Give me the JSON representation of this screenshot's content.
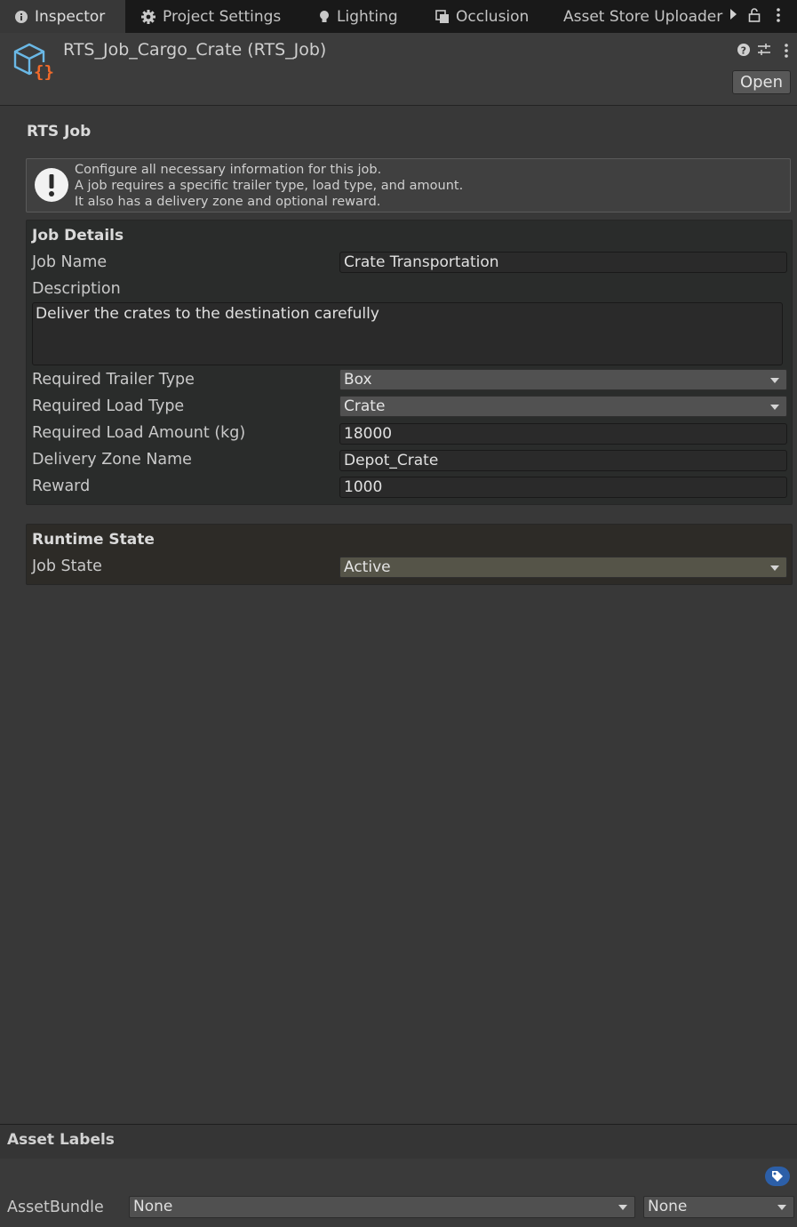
{
  "tabs": [
    {
      "label": "Inspector",
      "icon": "info-icon"
    },
    {
      "label": "Project Settings",
      "icon": "gear-icon"
    },
    {
      "label": "Lighting",
      "icon": "bulb-icon"
    },
    {
      "label": "Occlusion",
      "icon": "occlusion-icon"
    },
    {
      "label": "Asset Store Uploader"
    }
  ],
  "header": {
    "title": "RTS_Job_Cargo_Crate (RTS_Job)",
    "open_label": "Open"
  },
  "inspector": {
    "section_title": "RTS Job",
    "help": {
      "line1": "Configure all necessary information for this job.",
      "line2": "A job requires a specific trailer type, load type, and amount.",
      "line3": "It also has a delivery zone and optional reward."
    },
    "details": {
      "title": "Job Details",
      "job_name_label": "Job Name",
      "job_name_value": "Crate Transportation",
      "description_label": "Description",
      "description_value": "Deliver the crates to the destination carefully",
      "trailer_label": "Required Trailer Type",
      "trailer_value": "Box",
      "load_type_label": "Required Load Type",
      "load_type_value": "Crate",
      "load_amount_label": "Required Load Amount (kg)",
      "load_amount_value": "18000",
      "zone_label": "Delivery Zone Name",
      "zone_value": "Depot_Crate",
      "reward_label": "Reward",
      "reward_value": "1000"
    },
    "runtime": {
      "title": "Runtime State",
      "state_label": "Job State",
      "state_value": "Active"
    }
  },
  "footer": {
    "asset_labels_title": "Asset Labels",
    "assetbundle_label": "AssetBundle",
    "assetbundle_value": "None",
    "variant_value": "None"
  },
  "colors": {
    "tab_bar": "#191919",
    "panel": "#383838",
    "details_group": "#2a2c2b",
    "runtime_group": "#2d2b27",
    "accent_blue": "#2c5fa8",
    "asset_icon_blue": "#6ab8e6",
    "asset_icon_orange": "#f06a2b"
  }
}
